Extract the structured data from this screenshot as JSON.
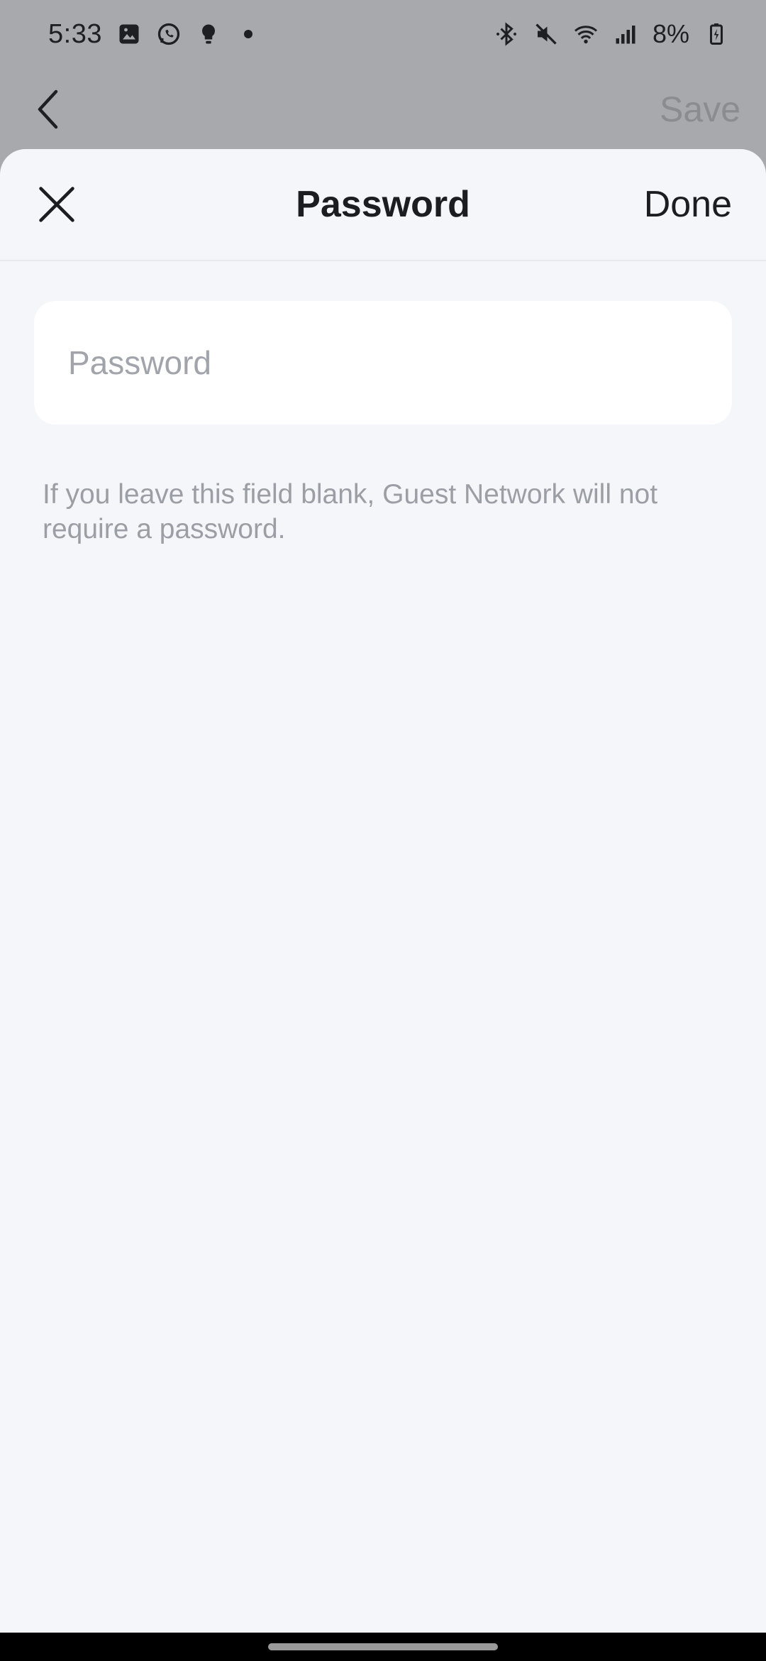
{
  "status_bar": {
    "time": "5:33",
    "battery": "8%",
    "left_icons": [
      "image-icon",
      "whatsapp-icon",
      "bulb-icon",
      "dot-icon"
    ],
    "right_icons": [
      "bluetooth-icon",
      "mute-icon",
      "wifi-icon",
      "signal-icon",
      "battery-icon"
    ]
  },
  "background_page": {
    "save_label": "Save"
  },
  "sheet": {
    "title": "Password",
    "done_label": "Done",
    "password_placeholder": "Password",
    "password_value": "",
    "hint": "If you leave this field blank, Guest Network will not require a password."
  },
  "colors": {
    "sheet_background": "#f4f6fa",
    "field_background": "#ffffff",
    "dim_overlay": "#a8a9ad",
    "hint_text": "#9b9ea4",
    "primary_text": "#1c1d20"
  }
}
